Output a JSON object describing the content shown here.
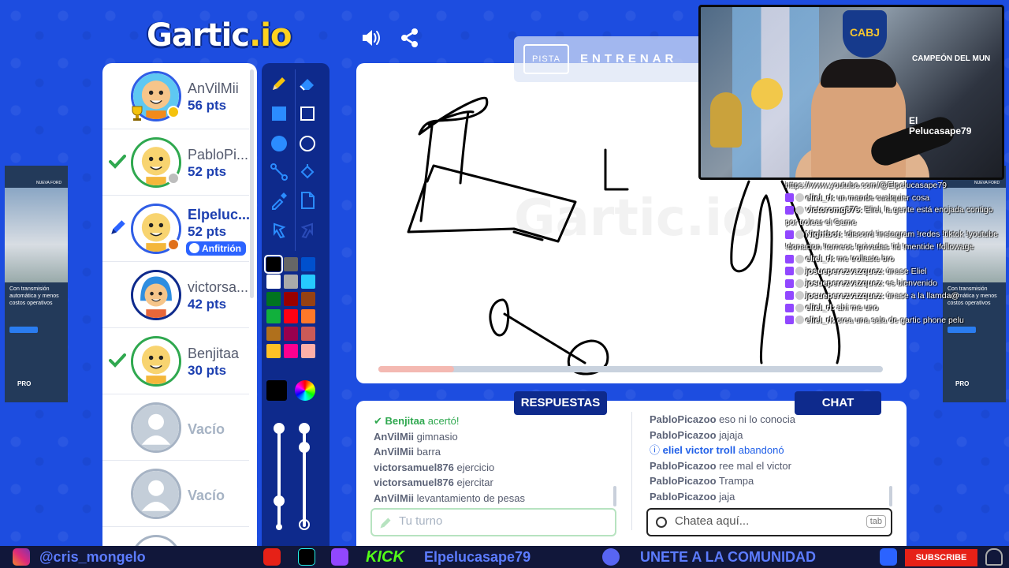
{
  "app": {
    "logo_main": "Gartic",
    "logo_suffix": ".io"
  },
  "hint_bar": {
    "hint_label": "PISTA",
    "train_label": "ENTRENAR"
  },
  "players": [
    {
      "name": "AnVilMii",
      "pts": "56 pts",
      "status": "winner",
      "dot": "#f4c20d"
    },
    {
      "name": "PabloPi...",
      "pts": "52 pts",
      "status": "guessed",
      "dot": "#bdbdbd"
    },
    {
      "name": "Elpeluc...",
      "pts": "52 pts",
      "status": "drawing",
      "dot": "#e0701a",
      "badge": "Anfitrión"
    },
    {
      "name": "victorsa...",
      "pts": "42 pts",
      "status": "none"
    },
    {
      "name": "Benjitaa",
      "pts": "30 pts",
      "status": "guessed"
    },
    {
      "name": "Vacío",
      "pts": "",
      "status": "empty"
    },
    {
      "name": "Vacío",
      "pts": "",
      "status": "empty"
    }
  ],
  "colors": {
    "palette": [
      "#000000",
      "#666666",
      "#0050cd",
      "#ffffff",
      "#aaaaaa",
      "#26c9ff",
      "#017420",
      "#990000",
      "#964112",
      "#11b03c",
      "#ff0013",
      "#ff7829",
      "#b0701c",
      "#99004e",
      "#cb5a57",
      "#ffc126",
      "#ff008f",
      "#feafa8"
    ],
    "selected": "#000000",
    "accent": "#1d4de0",
    "panel": "#0e2a8c"
  },
  "canvas": {
    "watermark": "Gartic.io",
    "time_remaining": 0.15
  },
  "answers": {
    "title": "RESPUESTAS",
    "messages": [
      {
        "user": "Benjitaa",
        "text": "acertó!",
        "type": "correct"
      },
      {
        "user": "AnVilMii",
        "text": "gimnasio"
      },
      {
        "user": "AnVilMii",
        "text": "barra"
      },
      {
        "user": "victorsamuel876",
        "text": "ejercicio"
      },
      {
        "user": "victorsamuel876",
        "text": "ejercitar"
      },
      {
        "user": "AnVilMii",
        "text": "levantamiento de pesas"
      }
    ],
    "placeholder": "Tu turno"
  },
  "chat": {
    "title": "CHAT",
    "messages": [
      {
        "user": "PabloPicazoo",
        "text": "eso ni lo conocia"
      },
      {
        "user": "PabloPicazoo",
        "text": "jajaja"
      },
      {
        "user": "eliel victor troll",
        "text": "abandonó",
        "type": "leave"
      },
      {
        "user": "PabloPicazoo",
        "text": "ree mal el victor"
      },
      {
        "user": "PabloPicazoo",
        "text": "Trampa"
      },
      {
        "user": "PabloPicazoo",
        "text": "jaja"
      }
    ],
    "placeholder": "Chatea aquí...",
    "tab_hint": "tab"
  },
  "webcam": {
    "crest": "CABJ",
    "sign": "El\nPelucasape79",
    "banner": "CAMPEÓN DEL MUN"
  },
  "stream_chat": [
    {
      "user": "",
      "text": "https://www.youtube.com/@Elpelucasape79"
    },
    {
      "user": "eliel_rl:",
      "text": "un mande cualquier cosa"
    },
    {
      "user": "victoromg876:",
      "text": "Eliel, la gente está enojada contigo por trolear el Game",
      "wrap": true
    },
    {
      "user": "Nightbot:",
      "text": "!discord !instagram !redes !tiktok !youtube !donacion !torneos !privadas !id !mentide !followage",
      "wrap": true
    },
    {
      "user": "eliel_rl:",
      "text": "me trollaste bro"
    },
    {
      "user": "josueperezvazquez:",
      "text": "únase Eliel"
    },
    {
      "user": "josueperezvazquez:",
      "text": "es bienvenido"
    },
    {
      "user": "josueperezvazquez:",
      "text": "únase a la llamda@"
    },
    {
      "user": "eliel_rl:",
      "text": "ahí me uno"
    },
    {
      "user": "eliel_rl:",
      "text": "crea una sala de gartic phone pelu"
    }
  ],
  "ads": {
    "headline": "NUEVA FORD TRANSIT MINIBUS",
    "body": "Con transmisión automática y menos costos operativos",
    "brand": "PRO"
  },
  "stream_bar": {
    "instagram": "@cris_mongelo",
    "kick_label": "KICK",
    "kick_user": "Elpelucasape79",
    "discord": "UNETE A LA COMUNIDAD",
    "subscribe": "SUBSCRIBE"
  }
}
